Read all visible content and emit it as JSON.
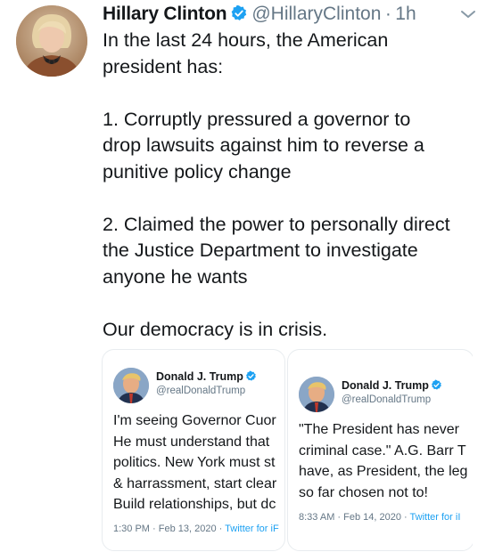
{
  "tweet": {
    "author_name": "Hillary Clinton",
    "handle": "@HillaryClinton",
    "separator": "·",
    "time": "1h",
    "text": "In the last 24 hours, the American\npresident has:\n\n1. Corruptly pressured a governor to\ndrop lawsuits against him to reverse a\npunitive policy change\n\n2. Claimed the power to personally direct\nthe Justice Department to investigate\nanyone he wants\n\nOur democracy is in crisis."
  },
  "embedded_tweets": [
    {
      "author_name": "Donald J. Trump",
      "handle": "@realDonaldTrump",
      "text": "I'm seeing Governor Cuor\nHe must understand that\npolitics. New York must st\n& harrassment, start clear\nBuild relationships, but dc",
      "meta_time": "1:30 PM · Feb 13, 2020 · ",
      "meta_source": "Twitter for iF"
    },
    {
      "author_name": "Donald J. Trump",
      "handle": "@realDonaldTrump",
      "text": "\"The President has never\ncriminal case.\" A.G. Barr T\nhave, as President, the leg\nso far chosen not to!",
      "meta_time": "8:33 AM · Feb 14, 2020 · ",
      "meta_source": "Twitter for iI"
    }
  ],
  "icons": [
    "avatar",
    "verified-badge-icon",
    "chevron-down-icon"
  ],
  "colors": {
    "text": "#14171a",
    "secondary": "#657786",
    "link": "#1da1f2",
    "verified": "#1da1f2",
    "border": "#e8ecef"
  }
}
